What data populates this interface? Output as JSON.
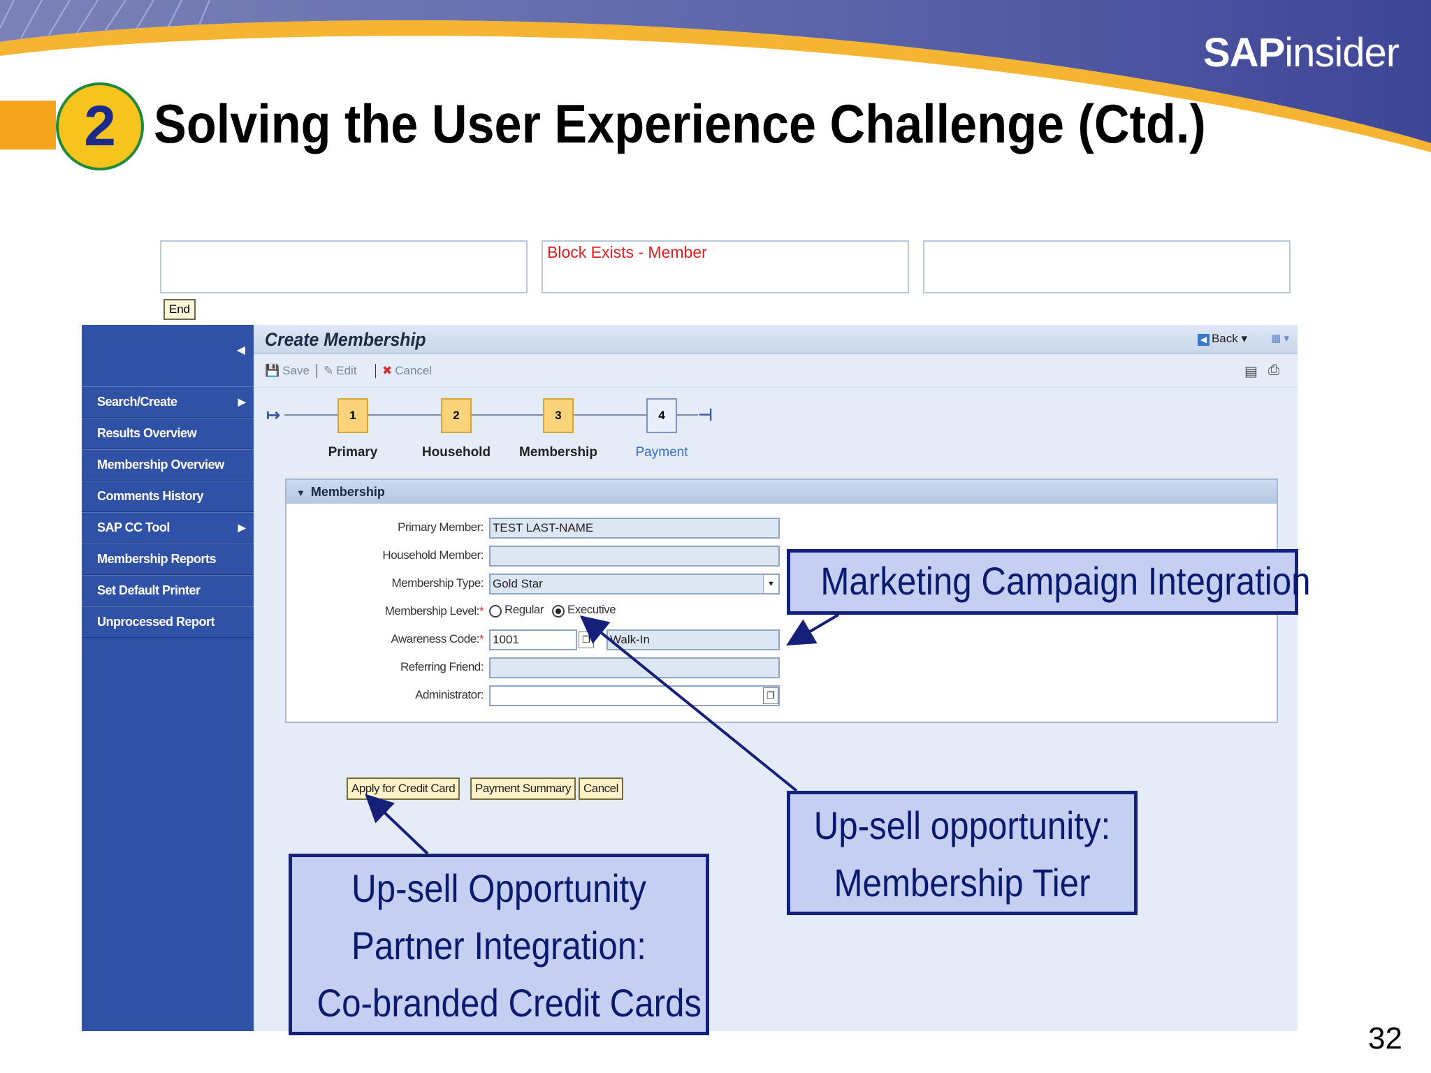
{
  "slide": {
    "brand_bold": "SAP",
    "brand_rest": "insider",
    "section_number": "2",
    "title": "Solving the User Experience Challenge (Ctd.)",
    "page_number": "32"
  },
  "messages": {
    "center": "Block Exists - Member",
    "end_button": "End"
  },
  "nav": {
    "items": [
      {
        "label": "Search/Create",
        "has_submenu": true
      },
      {
        "label": "Results Overview",
        "has_submenu": false
      },
      {
        "label": "Membership Overview",
        "has_submenu": false
      },
      {
        "label": "Comments History",
        "has_submenu": false
      },
      {
        "label": "SAP CC Tool",
        "has_submenu": true
      },
      {
        "label": "Membership Reports",
        "has_submenu": false
      },
      {
        "label": "Set Default Printer",
        "has_submenu": false
      },
      {
        "label": "Unprocessed Report",
        "has_submenu": false
      }
    ]
  },
  "window": {
    "title": "Create Membership",
    "back_label": "Back"
  },
  "toolbar": {
    "save": "Save",
    "edit": "Edit",
    "cancel": "Cancel"
  },
  "roadmap": {
    "steps": [
      {
        "number": "1",
        "label": "Primary"
      },
      {
        "number": "2",
        "label": "Household"
      },
      {
        "number": "3",
        "label": "Membership"
      },
      {
        "number": "4",
        "label": "Payment"
      }
    ],
    "active_step": 4
  },
  "form": {
    "section_title": "Membership",
    "primary_member": {
      "label": "Primary Member:",
      "value": "TEST LAST-NAME"
    },
    "household_member": {
      "label": "Household Member:",
      "value": ""
    },
    "membership_type": {
      "label": "Membership Type:",
      "value": "Gold Star"
    },
    "membership_level": {
      "label": "Membership Level:",
      "required": "*",
      "options": [
        "Regular",
        "Executive"
      ],
      "selected": "Executive"
    },
    "awareness_code": {
      "label": "Awareness Code:",
      "required": "*",
      "value": "1001",
      "description": "Walk-In"
    },
    "referring_friend": {
      "label": "Referring Friend:",
      "value": ""
    },
    "administrator": {
      "label": "Administrator:",
      "value": ""
    }
  },
  "actions": {
    "apply_credit_card": "Apply for Credit Card",
    "payment_summary": "Payment Summary",
    "cancel": "Cancel"
  },
  "callouts": {
    "marketing": [
      "Marketing Campaign Integration"
    ],
    "tier": [
      "Up-sell opportunity:",
      "Membership Tier"
    ],
    "partner": [
      "Up-sell Opportunity",
      "Partner Integration:",
      "Co-branded Credit Cards"
    ]
  },
  "colors": {
    "nav_bg": "#3052a6",
    "callout_bg": "#c5cff2",
    "callout_border": "#14207a",
    "accent_orange": "#f5a51c",
    "error_red": "#e02020"
  }
}
